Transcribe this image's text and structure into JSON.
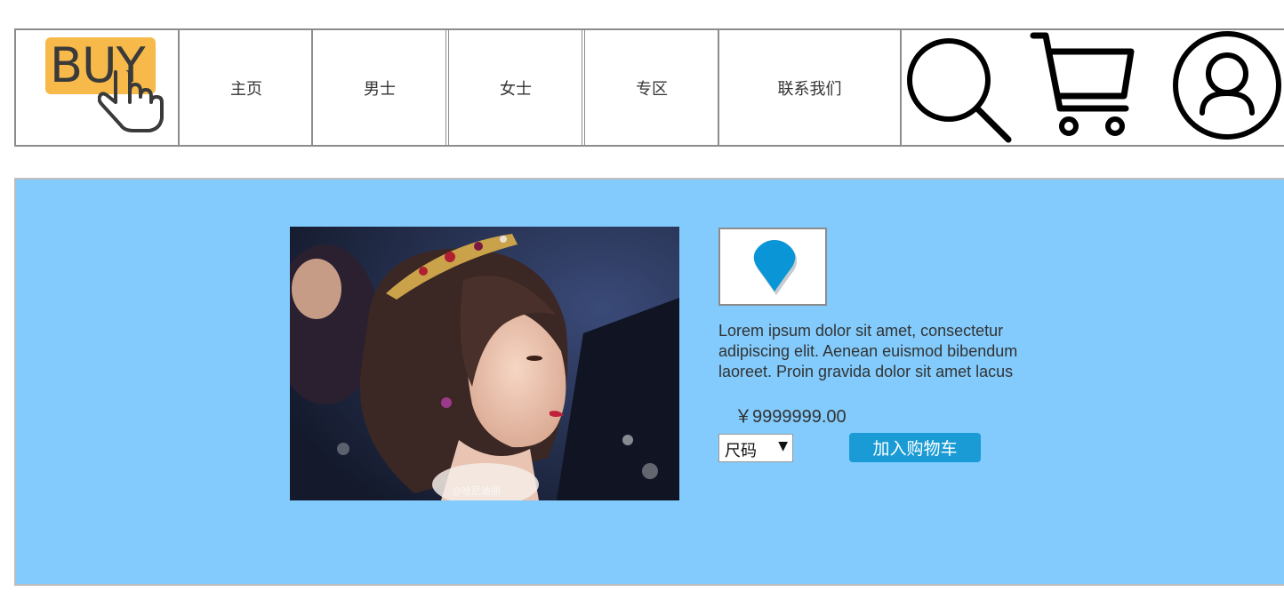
{
  "header": {
    "logo_text": "BUY",
    "nav": [
      {
        "label": "主页"
      },
      {
        "label": "男士"
      },
      {
        "label": "女士"
      },
      {
        "label": "专区"
      },
      {
        "label": "联系我们"
      }
    ],
    "icons": [
      "search-icon",
      "cart-icon",
      "user-icon"
    ]
  },
  "product": {
    "image_watermark": "@哈尼迪丽",
    "thumb_icon": "map-pin-icon",
    "description": "Lorem ipsum dolor sit amet, consectetur adipiscing elit. Aenean euismod bibendum laoreet. Proin gravida dolor sit amet lacus",
    "price": "￥9999999.00",
    "size_select": {
      "selected": "尺码"
    },
    "add_to_cart_label": "加入购物车"
  },
  "colors": {
    "panel_bg": "#82cbfc",
    "logo_bg": "#f6b94a",
    "button_bg": "#1a9bd5",
    "pin": "#0a96d6",
    "border": "#8c8c8c"
  }
}
